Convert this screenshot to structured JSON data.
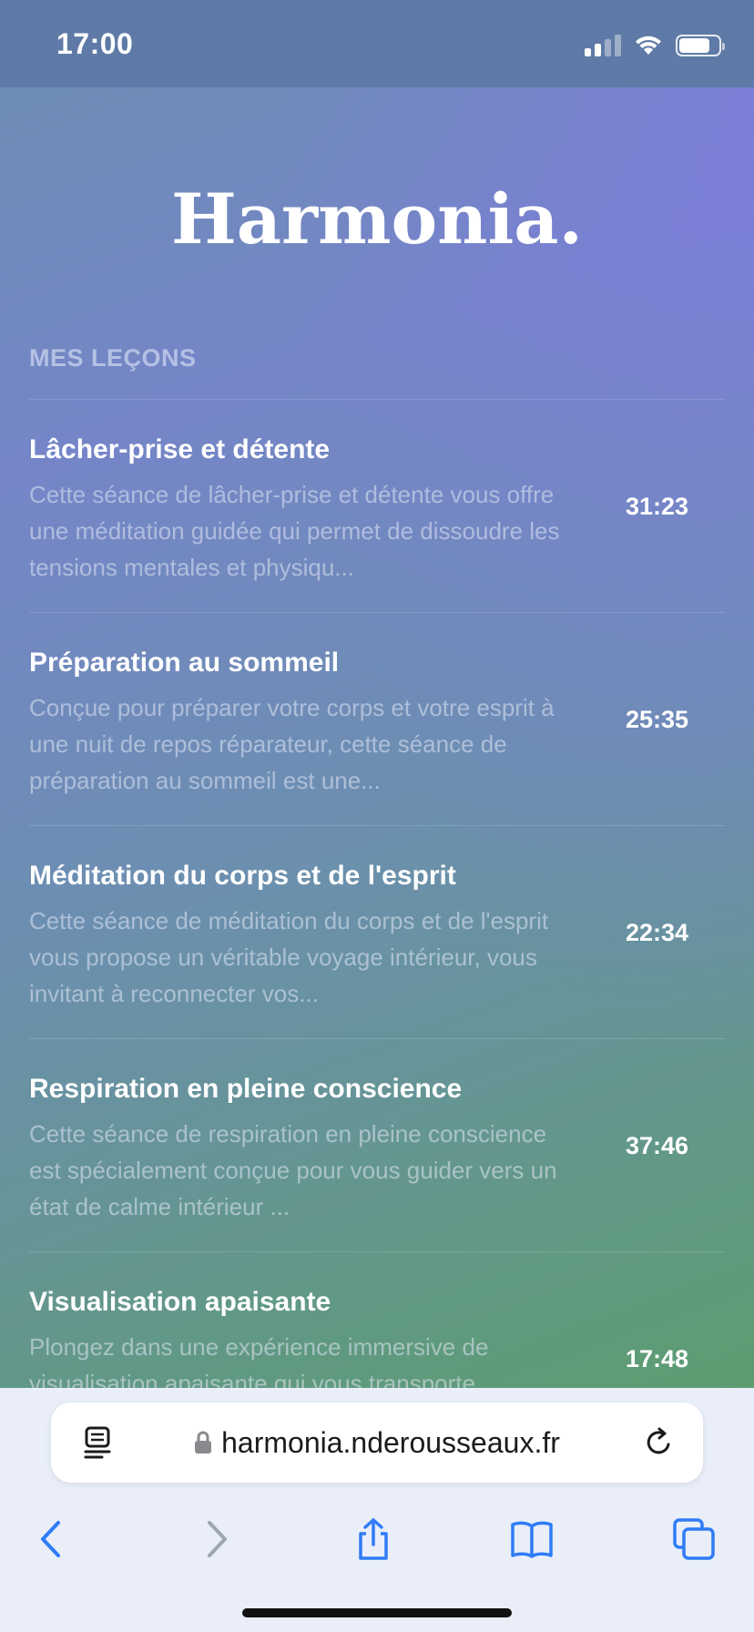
{
  "status": {
    "time": "17:00"
  },
  "app": {
    "brand": "Harmonia."
  },
  "section": {
    "title": "MES LEÇONS"
  },
  "lessons": [
    {
      "title": "Lâcher-prise et détente",
      "description": "Cette séance de lâcher-prise et détente vous offre une méditation guidée qui permet de dissoudre les tensions mentales et physiqu...",
      "duration": "31:23"
    },
    {
      "title": "Préparation au sommeil",
      "description": "Conçue pour préparer votre corps et votre esprit à une nuit de repos réparateur, cette séance de préparation au sommeil est une...",
      "duration": "25:35"
    },
    {
      "title": "Méditation du corps et de l'esprit",
      "description": "Cette séance de méditation du corps et de l'esprit vous propose un véritable voyage intérieur, vous invitant à reconnecter vos...",
      "duration": "22:34"
    },
    {
      "title": "Respiration en pleine conscience",
      "description": "Cette séance de respiration en pleine conscience est spécialement conçue pour vous guider vers un état de calme intérieur ...",
      "duration": "37:46"
    },
    {
      "title": "Visualisation apaisante",
      "description": "Plongez dans une expérience immersive de visualisation apaisante qui vous transporte",
      "duration": "17:48"
    }
  ],
  "browser": {
    "url": "harmonia.nderousseaux.fr",
    "accent_color": "#2f7cf6"
  },
  "icons": {
    "reader": "reader-mode-icon",
    "lock": "lock-icon",
    "reload": "reload-icon",
    "back": "chevron-left-icon",
    "forward": "chevron-right-icon",
    "share": "share-icon",
    "bookmarks": "book-icon",
    "tabs": "tabs-icon"
  }
}
